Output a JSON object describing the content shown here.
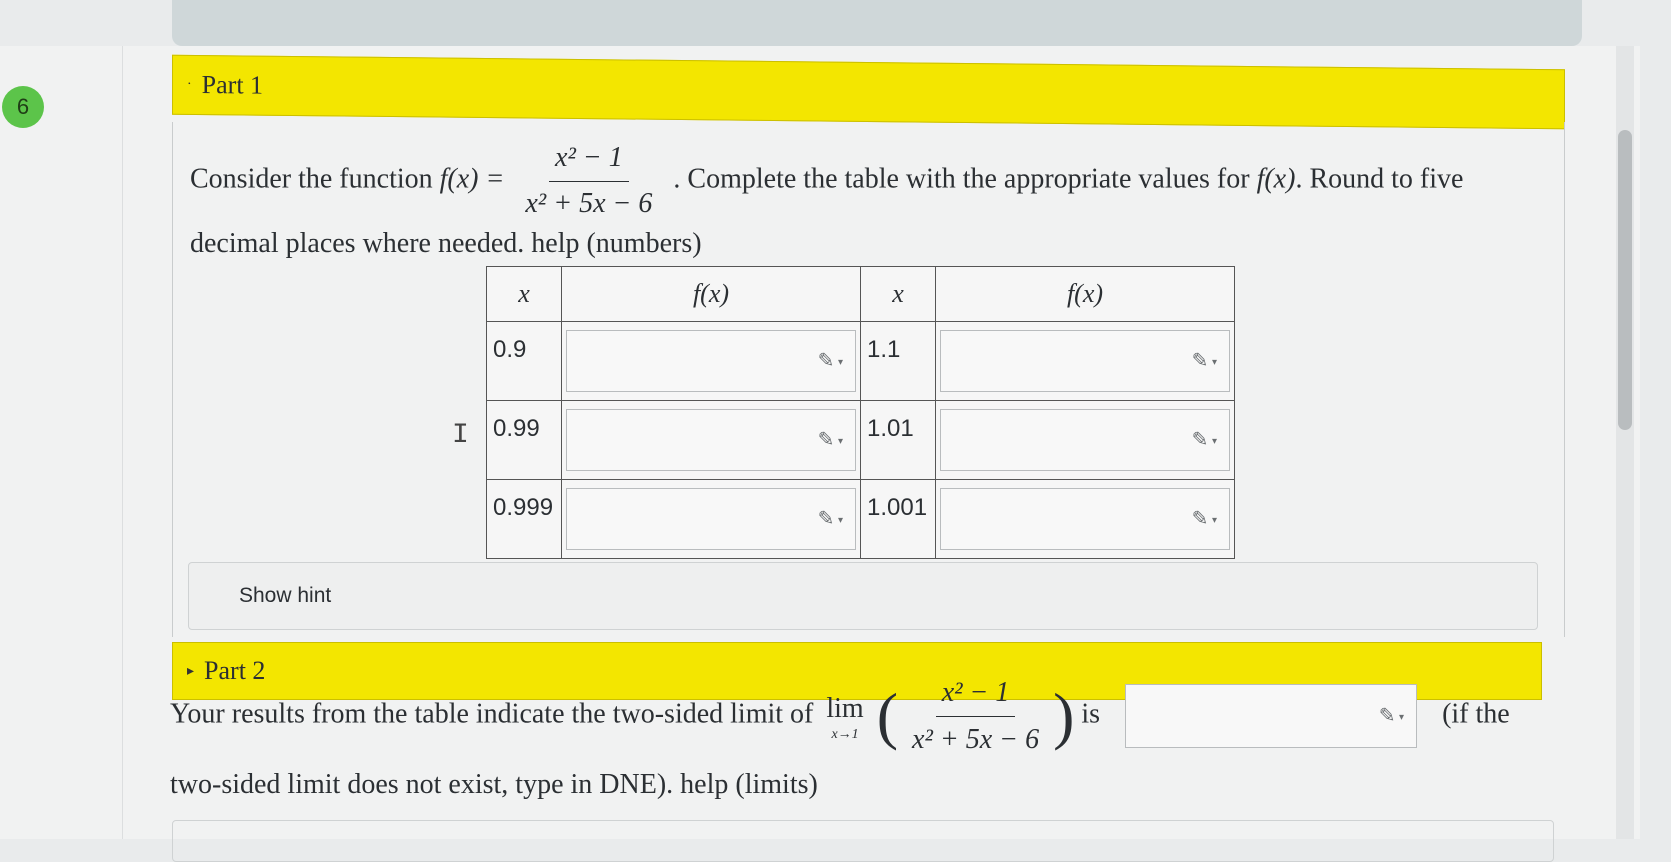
{
  "question_number": "6",
  "part1": {
    "label": "Part 1",
    "prompt_prefix": "Consider the function",
    "fx": "f(x) =",
    "numerator": "x² − 1",
    "denominator": "x² + 5x − 6",
    "prompt_mid": ". Complete the table with the appropriate values for",
    "fx_short": "f(x)",
    "prompt_suffix": ". Round to five decimal places where needed.",
    "help_link": "help (numbers)",
    "table": {
      "headers": [
        "x",
        "f(x)",
        "x",
        "f(x)"
      ],
      "rows": [
        {
          "x_left": "0.9",
          "f_left": "",
          "x_right": "1.1",
          "f_right": ""
        },
        {
          "x_left": "0.99",
          "f_left": "",
          "x_right": "1.01",
          "f_right": ""
        },
        {
          "x_left": "0.999",
          "f_left": "",
          "x_right": "1.001",
          "f_right": ""
        }
      ]
    },
    "hint_label": "Show hint"
  },
  "part2": {
    "label": "Part 2",
    "prompt_prefix": "Your results from the table indicate the two-sided limit of",
    "lim": "lim",
    "lim_sub": "x→1",
    "numerator": "x² − 1",
    "denominator": "x² + 5x − 6",
    "is": "is",
    "limit_value": "",
    "prompt_suffix": "(if the two-sided limit does not exist, type in DNE).",
    "help_link": "help (limits)"
  },
  "icons": {
    "edit": "pencil-icon",
    "text_cursor": "i-beam-cursor-icon"
  },
  "colors": {
    "part_bar": "#f3e600",
    "question_badge": "#5cc44a"
  }
}
